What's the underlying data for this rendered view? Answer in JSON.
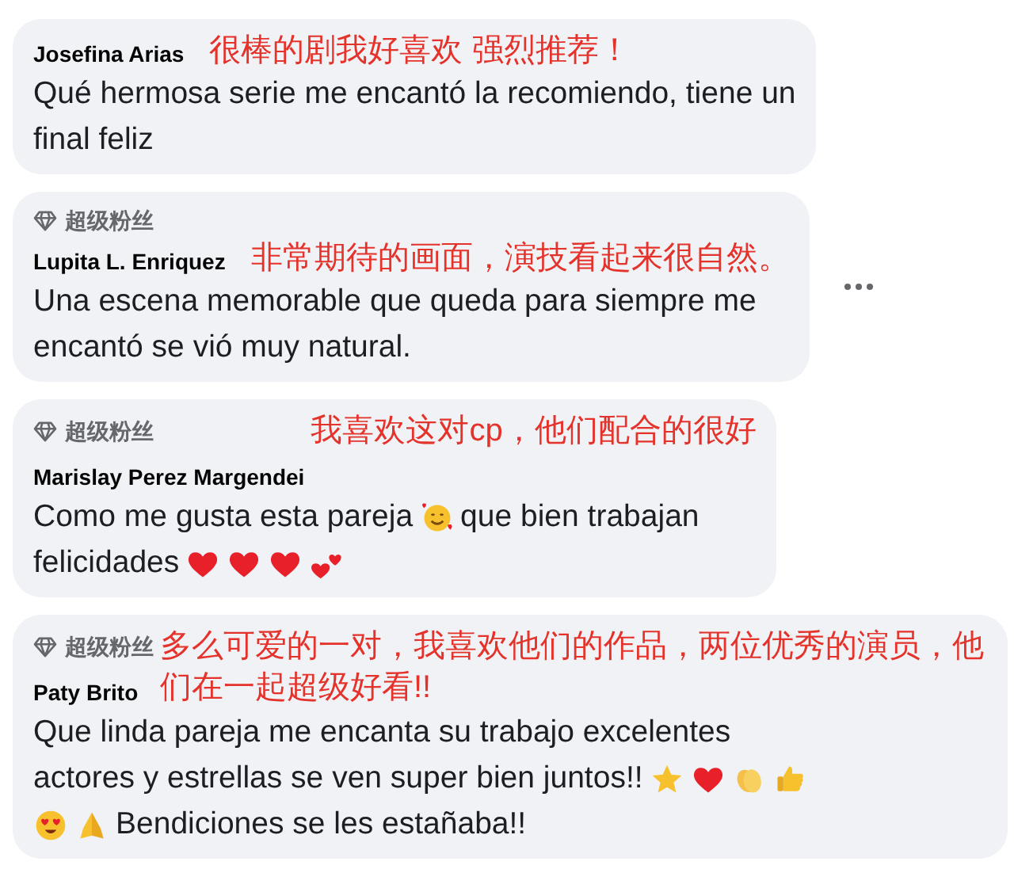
{
  "comments": [
    {
      "author": "Josefina Arias",
      "annotation": "很棒的剧我好喜欢 强烈推荐！",
      "kind": "inline",
      "body": [
        [
          {
            "kind": "text",
            "text": "Qué hermosa serie me encantó la recomiendo, tiene un"
          }
        ],
        [
          {
            "kind": "text",
            "text": "final feliz"
          }
        ]
      ]
    },
    {
      "badge": "超级粉丝",
      "author": "Lupita L. Enriquez",
      "annotation": "非常期待的画面，演技看起来很自然。",
      "kind": "inline",
      "more_button": true,
      "body": [
        [
          {
            "kind": "text",
            "text": "Una escena memorable que queda para siempre me"
          }
        ],
        [
          {
            "kind": "text",
            "text": "encantó se vió muy natural."
          }
        ]
      ]
    },
    {
      "badge": "超级粉丝",
      "author": "Marislay Perez Margendei",
      "annotation": "我喜欢这对cp，他们配合的很好",
      "kind": "beside",
      "body": [
        [
          {
            "kind": "text",
            "text": "Como me gusta esta pareja"
          },
          {
            "kind": "hearts-face"
          },
          {
            "kind": "text",
            "text": "que bien trabajan"
          }
        ],
        [
          {
            "kind": "text",
            "text": "felicidades"
          },
          {
            "kind": "heart"
          },
          {
            "kind": "heart"
          },
          {
            "kind": "heart"
          },
          {
            "kind": "two-hearts"
          }
        ]
      ]
    },
    {
      "badge": "超级粉丝",
      "author": "Paty Brito",
      "annotation": "多么可爱的一对，我喜欢他们的作品，两位优秀的演员，他们在一起超级好看!!",
      "kind": "beside",
      "body": [
        [
          {
            "kind": "text",
            "text": "Que linda pareja me encanta su trabajo excelentes"
          }
        ],
        [
          {
            "kind": "text",
            "text": "actores y estrellas se ven super bien juntos!!"
          },
          {
            "kind": "star"
          },
          {
            "kind": "heart"
          },
          {
            "kind": "clap"
          },
          {
            "kind": "thumb"
          }
        ],
        [
          {
            "kind": "heart-eyes"
          },
          {
            "kind": "pray"
          },
          {
            "kind": "text",
            "text": "Bendiciones se les estañaba!!"
          }
        ]
      ]
    }
  ]
}
